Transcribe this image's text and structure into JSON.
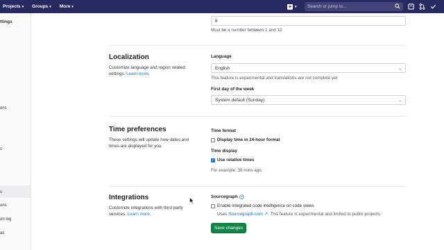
{
  "navbar": {
    "items": [
      {
        "label": "Projects"
      },
      {
        "label": "Groups"
      },
      {
        "label": "More"
      }
    ],
    "search_placeholder": "Search or jump to..."
  },
  "sidebar": {
    "title": "ttings",
    "fragments": [
      "ons",
      "s",
      "s",
      "ons",
      "on log",
      "as"
    ]
  },
  "top_field": {
    "value": "8",
    "hint": "Must be a number between 1 and 12"
  },
  "localization": {
    "title": "Localization",
    "description": "Customize language and region related settings.",
    "learn_more": "Learn more",
    "language_label": "Language",
    "language_value": "English",
    "language_hint": "This feature is experimental and translations are not complete yet",
    "first_day_label": "First day of the week",
    "first_day_value": "System default (Sunday)"
  },
  "time_preferences": {
    "title": "Time preferences",
    "description": "These settings will update how dates and times are displayed for you.",
    "time_format_label": "Time format",
    "display_24h_label": "Display time in 24-hour format",
    "display_24h_checked": false,
    "time_display_label": "Time display",
    "relative_label": "Use relative times",
    "relative_checked": true,
    "example": "For example: 30 mins ago."
  },
  "integrations": {
    "title": "Integrations",
    "description": "Customize integrations with third party services.",
    "learn_more": "Learn more",
    "sourcegraph_label": "Sourcegraph",
    "enable_label": "Enable integrated code intelligence on code views",
    "enable_checked": false,
    "uses_prefix": "Uses",
    "uses_link": "Sourcegraph.com",
    "uses_suffix": ". This feature is experimental and limited to public projects."
  },
  "actions": {
    "save_label": "Save changes"
  },
  "colors": {
    "navbar": "#292961",
    "link": "#1f75cb",
    "primary_button": "#108548"
  }
}
